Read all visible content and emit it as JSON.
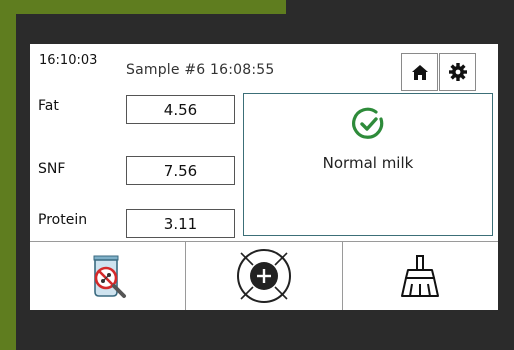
{
  "header": {
    "time": "16:10:03",
    "sample": "Sample #6 16:08:55"
  },
  "icons": {
    "home": "home-icon",
    "settings": "gear-icon",
    "status": "check-circle-icon",
    "test": "sample-beaker-icon",
    "add": "add-circle-icon",
    "clean": "broom-icon"
  },
  "measurements": [
    {
      "label": "Fat",
      "value": "4.56"
    },
    {
      "label": "SNF",
      "value": "7.56"
    },
    {
      "label": "Protein",
      "value": "3.11"
    }
  ],
  "status": {
    "text": "Normal milk",
    "color": "#2e8b3a"
  },
  "colors": {
    "accent_teal": "#3c6f78",
    "frame_green": "#5f7d1f"
  }
}
